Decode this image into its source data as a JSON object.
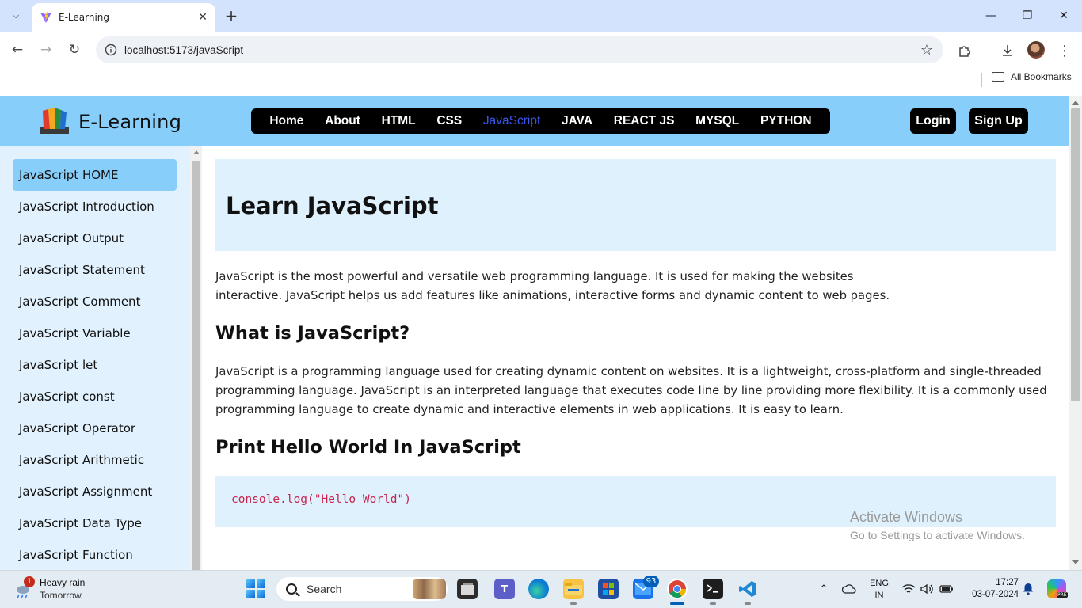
{
  "browser": {
    "tab_title": "E-Learning",
    "url": "localhost:5173/javaScript",
    "bookmarks_label": "All Bookmarks"
  },
  "header": {
    "brand": "E-Learning",
    "nav": [
      "Home",
      "About",
      "HTML",
      "CSS",
      "JavaScript",
      "JAVA",
      "REACT JS",
      "MYSQL",
      "PYTHON"
    ],
    "active_nav": "JavaScript",
    "login": "Login",
    "signup": "Sign Up"
  },
  "sidebar": {
    "items": [
      "JavaScript HOME",
      "JavaScript Introduction",
      "JavaScript Output",
      "JavaScript Statement",
      "JavaScript Comment",
      "JavaScript Variable",
      "JavaScript let",
      "JavaScript const",
      "JavaScript Operator",
      "JavaScript Arithmetic",
      "JavaScript Assignment",
      "JavaScript Data Type",
      "JavaScript Function"
    ],
    "active_index": 0
  },
  "main": {
    "title": "Learn JavaScript",
    "intro_line1": "JavaScript is the most powerful and versatile web programming language. It is used for making the websites",
    "intro_line2": "interactive. JavaScript helps us add features like animations, interactive forms and dynamic content to web pages.",
    "what_heading": "What is JavaScript?",
    "what_line1": "JavaScript is a programming language used for creating dynamic content on websites. It is a lightweight, cross-platform and single-threaded",
    "what_line2": "programming language. JavaScript is an interpreted language that executes code line by line providing more flexibility. It is a commonly used",
    "what_line3": "programming language to create dynamic and interactive elements in web applications. It is easy to learn.",
    "print_heading": "Print Hello World In JavaScript",
    "code": "console.log(\"Hello World\")"
  },
  "watermark": {
    "line1": "Activate Windows",
    "line2": "Go to Settings to activate Windows."
  },
  "taskbar": {
    "weather_title": "Heavy rain",
    "weather_sub": "Tomorrow",
    "weather_badge": "1",
    "search": "Search",
    "mail_badge": "93",
    "lang1": "ENG",
    "lang2": "IN",
    "time": "17:27",
    "date": "03-07-2024"
  }
}
